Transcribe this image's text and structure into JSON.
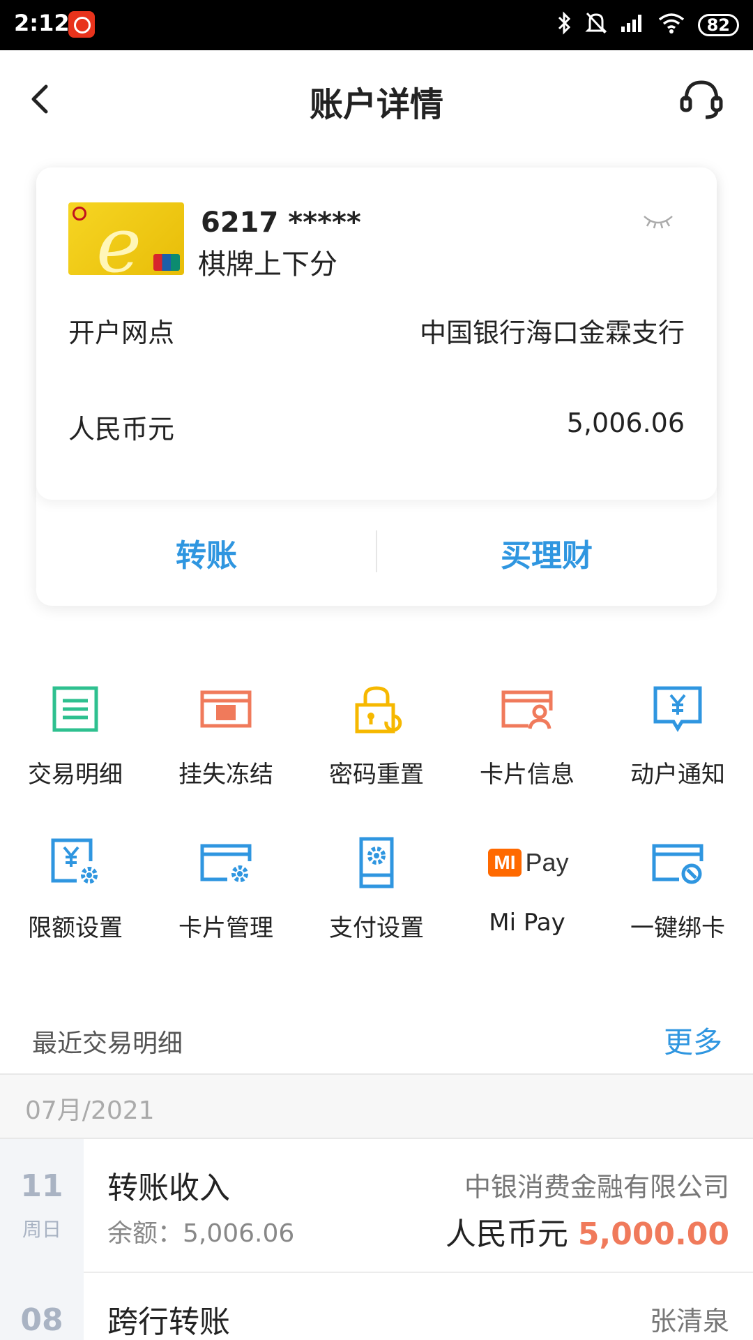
{
  "status_bar": {
    "time": "2:12",
    "battery": "82",
    "icons": [
      "bluetooth-icon",
      "mute-bell-icon",
      "signal-icon",
      "wifi-icon"
    ]
  },
  "header": {
    "title": "账户详情",
    "back_icon": "chevron-left-icon",
    "service_icon": "headset-icon"
  },
  "card": {
    "number": "6217 *****",
    "name": "棋牌上下分",
    "eye_icon": "eye-closed-icon",
    "rows": [
      {
        "label": "开户网点",
        "value": "中国银行海口金霖支行"
      },
      {
        "label": "人民币元",
        "value": "5,006.06"
      }
    ],
    "actions": {
      "transfer": "转账",
      "wealth": "买理财"
    }
  },
  "grid": [
    {
      "label": "交易明细",
      "icon": "list-document-icon",
      "color": "#2ec08f"
    },
    {
      "label": "挂失冻结",
      "icon": "lost-card-icon",
      "color": "#f07a5b"
    },
    {
      "label": "密码重置",
      "icon": "lock-reset-icon",
      "color": "#f6b800"
    },
    {
      "label": "卡片信息",
      "icon": "card-user-icon",
      "color": "#f07a5b"
    },
    {
      "label": "动户通知",
      "icon": "yuan-notice-icon",
      "color": "#2f96e0"
    },
    {
      "label": "限额设置",
      "icon": "limit-settings-icon",
      "color": "#2f96e0"
    },
    {
      "label": "卡片管理",
      "icon": "card-gear-icon",
      "color": "#2f96e0"
    },
    {
      "label": "支付设置",
      "icon": "phone-gear-icon",
      "color": "#2f96e0"
    },
    {
      "label": "Mi Pay",
      "icon": "mi-pay-logo-icon",
      "color": "#ff6900"
    },
    {
      "label": "一键绑卡",
      "icon": "card-bind-icon",
      "color": "#2f96e0"
    }
  ],
  "mipay_logo": {
    "mi": "MI",
    "pay": "Pay"
  },
  "recent": {
    "title": "最近交易明细",
    "more": "更多",
    "month": "07月/2021",
    "transactions": [
      {
        "day": "11",
        "weekday": "周日",
        "type": "转账收入",
        "balance": "余额：5,006.06",
        "counterparty": "中银消费金融有限公司",
        "currency": "人民币元",
        "amount": "5,000.00"
      },
      {
        "day": "08",
        "weekday": "",
        "type": "跨行转账",
        "balance": "",
        "counterparty": "张清泉",
        "currency": "",
        "amount": ""
      }
    ]
  },
  "colors": {
    "accent": "#2f96e0",
    "income": "#f07a5b"
  }
}
